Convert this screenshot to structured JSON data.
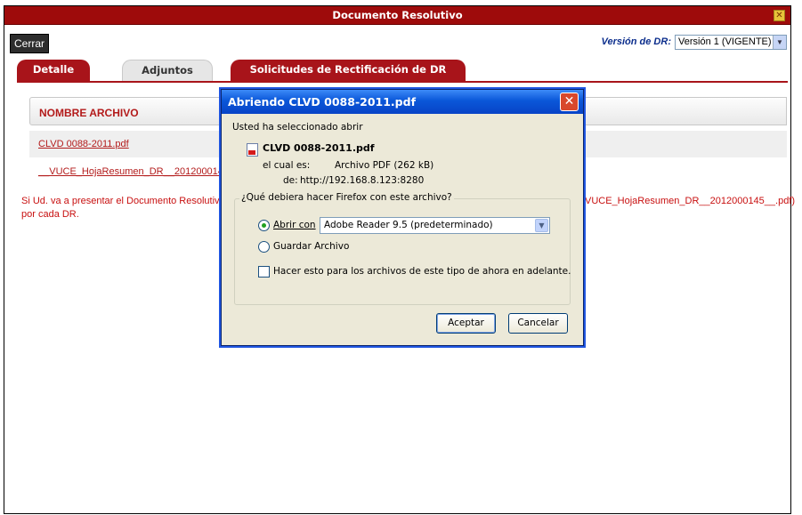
{
  "window": {
    "title": "Documento Resolutivo",
    "close_glyph": "✕"
  },
  "toolbar": {
    "close_label": "Cerrar",
    "version_label": "Versión de DR:",
    "version_selected": "Versión 1 (VIGENTE)"
  },
  "tabs": [
    {
      "label": "Detalle",
      "active": true
    },
    {
      "label": "Adjuntos",
      "active": false
    },
    {
      "label": "Solicitudes de Rectificación de DR",
      "active": true
    }
  ],
  "files": {
    "header": "NOMBRE ARCHIVO",
    "rows": [
      "CLVD 0088-2011.pdf",
      "__VUCE_HojaResumen_DR__2012000145"
    ]
  },
  "notice": {
    "line1_left": "Si Ud. va a presentar el Documento Resolutivo (",
    "line1_right": "VUCE_HojaResumen_DR__2012000145__.pdf)",
    "line2": "por cada DR."
  },
  "dialog": {
    "title": "Abriendo CLVD 0088-2011.pdf",
    "intro": "Usted ha seleccionado abrir",
    "filename": "CLVD 0088-2011.pdf",
    "type_label": "el cual es:",
    "type_value": "Archivo PDF (262 kB)",
    "from_label": "de:",
    "from_value": "http://192.168.8.123:8280",
    "question": "¿Qué debiera hacer Firefox con este archivo?",
    "open_with_label": "Abrir con",
    "open_with_app": "Adobe Reader 9.5 (predeterminado)",
    "save_label": "Guardar Archivo",
    "remember_label": "Hacer esto para los archivos de este tipo de ahora en adelante.",
    "accept_label": "Aceptar",
    "cancel_label": "Cancelar"
  }
}
